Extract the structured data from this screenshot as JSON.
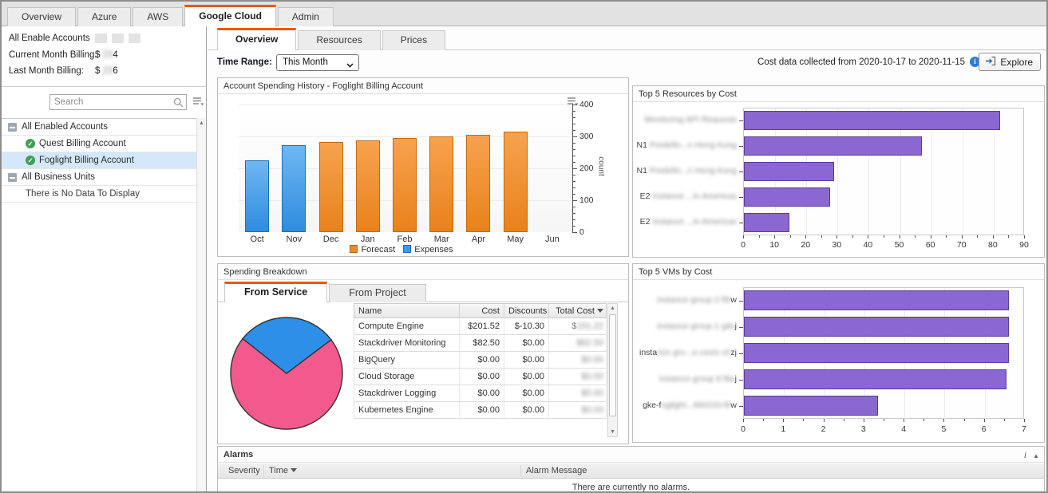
{
  "app": {
    "top_tabs": [
      {
        "label": "Overview",
        "active": false
      },
      {
        "label": "Azure",
        "active": false
      },
      {
        "label": "AWS",
        "active": false
      },
      {
        "label": "Google Cloud",
        "active": true
      },
      {
        "label": "Admin",
        "active": false
      }
    ]
  },
  "sidebar": {
    "title": "All Enable Accounts",
    "billing": [
      {
        "label": "Current Month Billing:",
        "prefix": "$ ",
        "blurred": "23",
        "suffix": "4"
      },
      {
        "label": "Last Month Billing:",
        "prefix": "$ ",
        "blurred": "23",
        "suffix": "6"
      }
    ],
    "search_placeholder": "Search",
    "tree": [
      {
        "label": "All Enabled Accounts",
        "kind": "group",
        "selected": false
      },
      {
        "label": "Quest Billing Account",
        "kind": "account",
        "selected": false
      },
      {
        "label": "Foglight Billing Account",
        "kind": "account",
        "selected": true
      },
      {
        "label": "All Business Units",
        "kind": "group",
        "selected": false
      },
      {
        "label": "There is No Data To Display",
        "kind": "empty",
        "selected": false
      }
    ]
  },
  "main": {
    "tabs": [
      {
        "label": "Overview",
        "active": true
      },
      {
        "label": "Resources",
        "active": false
      },
      {
        "label": "Prices",
        "active": false
      }
    ],
    "time_range_label": "Time Range:",
    "time_range_value": "This Month",
    "cost_note": "Cost data collected from 2020-10-17 to 2020-11-15",
    "explore_label": "Explore"
  },
  "panels": {
    "breakdown_title": "Spending Breakdown"
  },
  "chart_data": [
    {
      "id": "spending_history",
      "type": "bar",
      "title": "Account Spending History - Foglight Billing Account",
      "categories": [
        "Oct",
        "Nov",
        "Dec",
        "Jan",
        "Feb",
        "Mar",
        "Apr",
        "May",
        "Jun"
      ],
      "series": [
        {
          "name": "Expenses",
          "color": "#3d9ae8",
          "values": [
            225,
            272,
            null,
            null,
            null,
            null,
            null,
            null,
            null
          ]
        },
        {
          "name": "Forecast",
          "color": "#f08a28",
          "values": [
            null,
            null,
            282,
            287,
            294,
            300,
            306,
            314,
            null
          ]
        }
      ],
      "ylabel": "count",
      "ylim": [
        0,
        400
      ],
      "yticks": [
        0,
        100,
        200,
        300,
        400
      ],
      "legend": [
        "Forecast",
        "Expenses"
      ],
      "legend_position": "bottom",
      "axis_side": "right",
      "grid": true
    },
    {
      "id": "top_resources",
      "type": "bar-horizontal",
      "title": "Top 5 Resources by Cost",
      "bar_color": "#8a67d1",
      "categories_redacted": [
        {
          "prefix": "",
          "blurred": "Monitoring API Requests",
          "suffix": ""
        },
        {
          "prefix": "N1",
          "blurred": " Predefin...n Hong Kong",
          "suffix": ""
        },
        {
          "prefix": "N1",
          "blurred": " Predefin...n Hong Kong",
          "suffix": ""
        },
        {
          "prefix": "E2",
          "blurred": " Instance ...in Americas",
          "suffix": ""
        },
        {
          "prefix": "E2",
          "blurred": " Instance ...in Americas",
          "suffix": ""
        }
      ],
      "values": [
        82,
        57,
        29,
        27.5,
        14.5
      ],
      "xlim": [
        0,
        90
      ],
      "xticks": [
        0,
        10,
        20,
        30,
        40,
        50,
        60,
        70,
        80,
        90
      ],
      "grid": true
    },
    {
      "id": "spending_pie",
      "type": "pie",
      "start_angle_deg": 53,
      "slices": [
        {
          "label": "Compute Engine",
          "value": 201.52,
          "color": "#f2598c"
        },
        {
          "label": "Stackdriver Monitoring",
          "value": 82.5,
          "color": "#2e8fe8"
        }
      ]
    },
    {
      "id": "top_vms",
      "type": "bar-horizontal",
      "title": "Top 5 VMs by Cost",
      "bar_color": "#8a67d1",
      "categories_redacted": [
        {
          "prefix": "",
          "blurred": "instance group 2 f9t",
          "suffix": "w"
        },
        {
          "prefix": "",
          "blurred": "instance group 1 g8s",
          "suffix": "j"
        },
        {
          "prefix": "insta",
          "blurred": "nce gro...a cores ch",
          "suffix": "zj"
        },
        {
          "prefix": "",
          "blurred": "instance group 8 f8a",
          "suffix": "j"
        },
        {
          "prefix": "gke-f",
          "blurred": "oglight...460233-f9",
          "suffix": "w"
        }
      ],
      "values": [
        6.6,
        6.6,
        6.6,
        6.55,
        3.35
      ],
      "xlim": [
        0,
        7
      ],
      "xticks": [
        0,
        1,
        2,
        3,
        4,
        5,
        6,
        7
      ],
      "grid": true
    }
  ],
  "breakdown": {
    "tabs": [
      {
        "label": "From Service",
        "active": true
      },
      {
        "label": "From Project",
        "active": false
      }
    ],
    "table": {
      "columns": [
        "Name",
        "Cost",
        "Discounts",
        "Total Cost"
      ],
      "sorted_column": "Total Cost",
      "rows": [
        {
          "name": "Compute Engine",
          "cost": "$201.52",
          "discounts": "$-10.30",
          "total_prefix": "$",
          "total_blurred": "191.22"
        },
        {
          "name": "Stackdriver Monitoring",
          "cost": "$82.50",
          "discounts": "$0.00",
          "total_prefix": "",
          "total_blurred": "$82.50"
        },
        {
          "name": "BigQuery",
          "cost": "$0.00",
          "discounts": "$0.00",
          "total_prefix": "",
          "total_blurred": "$0.00"
        },
        {
          "name": "Cloud Storage",
          "cost": "$0.00",
          "discounts": "$0.00",
          "total_prefix": "",
          "total_blurred": "$0.00"
        },
        {
          "name": "Stackdriver Logging",
          "cost": "$0.00",
          "discounts": "$0.00",
          "total_prefix": "",
          "total_blurred": "$0.00"
        },
        {
          "name": "Kubernetes Engine",
          "cost": "$0.00",
          "discounts": "$0.00",
          "total_prefix": "",
          "total_blurred": "$0.00"
        }
      ]
    }
  },
  "alarms": {
    "title": "Alarms",
    "columns": [
      "Severity",
      "Time",
      "Alarm Message"
    ],
    "sorted_column": "Time",
    "empty_message": "There are currently no alarms."
  }
}
